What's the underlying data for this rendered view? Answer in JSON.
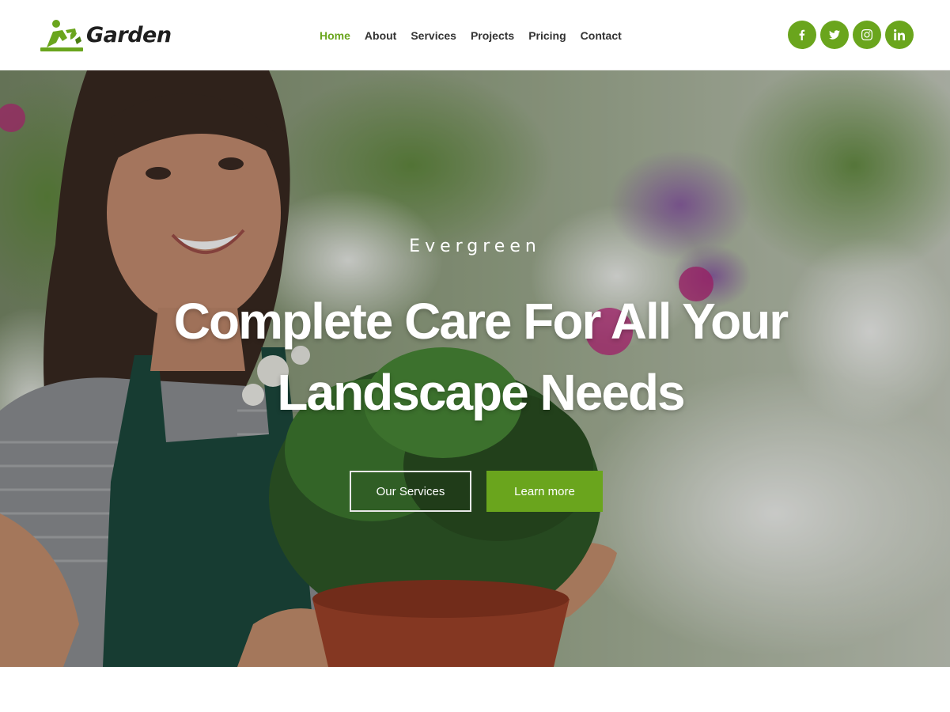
{
  "brand": {
    "name": "Garden",
    "accent_color": "#6aa51d"
  },
  "nav": {
    "items": [
      {
        "label": "Home",
        "active": true
      },
      {
        "label": "About",
        "active": false
      },
      {
        "label": "Services",
        "active": false
      },
      {
        "label": "Projects",
        "active": false
      },
      {
        "label": "Pricing",
        "active": false
      },
      {
        "label": "Contact",
        "active": false
      }
    ]
  },
  "social": [
    {
      "icon": "facebook-icon"
    },
    {
      "icon": "twitter-icon"
    },
    {
      "icon": "instagram-icon"
    },
    {
      "icon": "linkedin-icon"
    }
  ],
  "hero": {
    "eyebrow": "Evergreen",
    "headline": "Complete Care For All Your Landscape Needs",
    "primary_button": "Our Services",
    "secondary_button": "Learn more"
  }
}
